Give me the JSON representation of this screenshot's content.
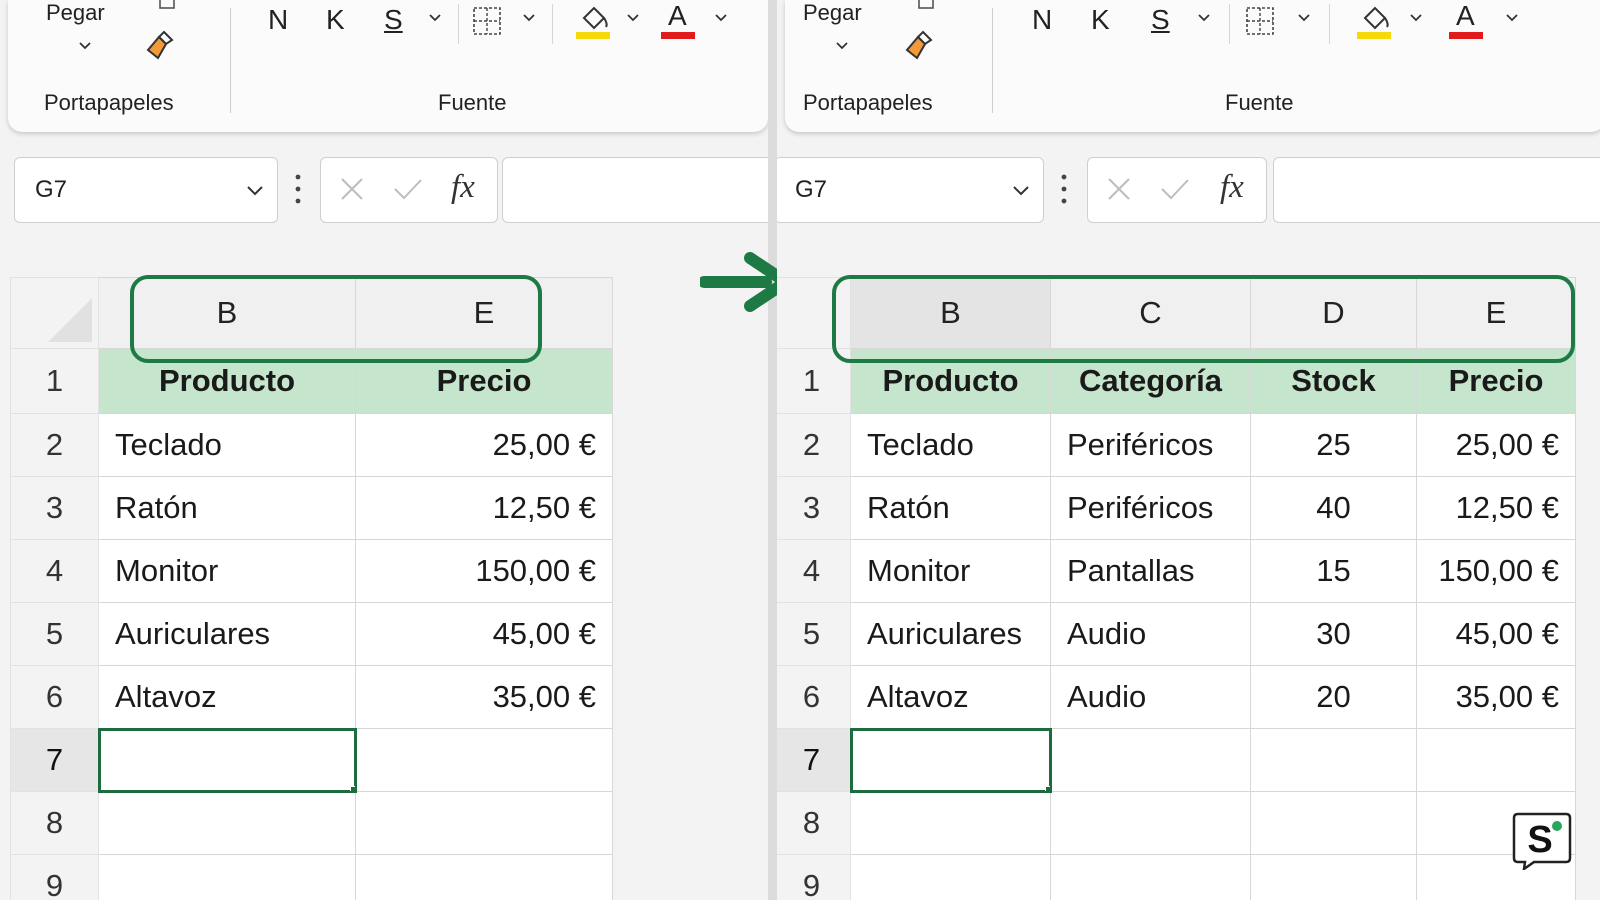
{
  "ribbon": {
    "paste_label": "Pegar",
    "clipboard_group": "Portapapeles",
    "font_group": "Fuente",
    "bold_label": "N",
    "italic_label": "K",
    "underline_label": "S",
    "font_color_label": "A",
    "highlight_color": "#f5d90a",
    "font_color": "#e01b1b"
  },
  "formula_bar": {
    "name_box": "G7",
    "fx_label": "fx",
    "value": ""
  },
  "accent_color": "#1e7a45",
  "header_fill": "#c6e5cd",
  "left_sheet": {
    "columns": [
      "B",
      "E"
    ],
    "rows": [
      "1",
      "2",
      "3",
      "4",
      "5",
      "6",
      "7",
      "8",
      "9"
    ],
    "headers": [
      "Producto",
      "Precio"
    ],
    "data": [
      [
        "Teclado",
        "25,00 €"
      ],
      [
        "Ratón",
        "12,50 €"
      ],
      [
        "Monitor",
        "150,00 €"
      ],
      [
        "Auriculares",
        "45,00 €"
      ],
      [
        "Altavoz",
        "35,00 €"
      ]
    ]
  },
  "right_sheet": {
    "columns": [
      "B",
      "C",
      "D",
      "E"
    ],
    "rows": [
      "1",
      "2",
      "3",
      "4",
      "5",
      "6",
      "7",
      "8",
      "9"
    ],
    "headers": [
      "Producto",
      "Categoría",
      "Stock",
      "Precio"
    ],
    "data": [
      [
        "Teclado",
        "Periféricos",
        "25",
        "25,00 €"
      ],
      [
        "Ratón",
        "Periféricos",
        "40",
        "12,50 €"
      ],
      [
        "Monitor",
        "Pantallas",
        "15",
        "150,00 €"
      ],
      [
        "Auriculares",
        "Audio",
        "30",
        "45,00 €"
      ],
      [
        "Altavoz",
        "Audio",
        "20",
        "35,00 €"
      ]
    ]
  },
  "logo_letter": "S"
}
